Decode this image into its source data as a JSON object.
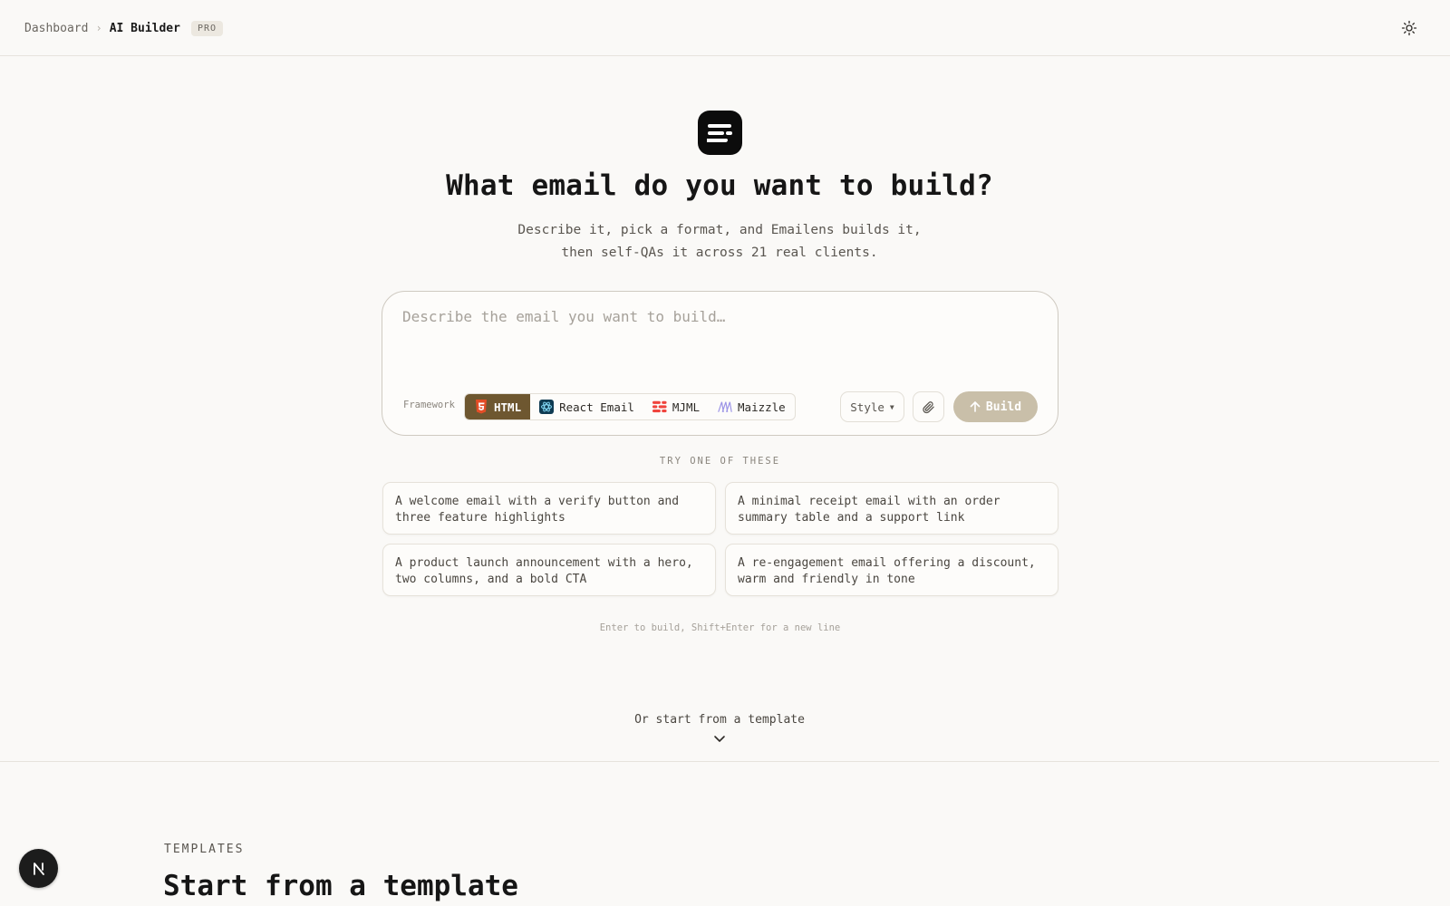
{
  "breadcrumb": {
    "parent": "Dashboard",
    "separator": "›",
    "current": "AI Builder",
    "badge": "PRO"
  },
  "hero": {
    "title": "What email do you want to build?",
    "subtitle_line1": "Describe it, pick a format, and Emailens builds it,",
    "subtitle_line2": "then self-QAs it across 21 real clients."
  },
  "composer": {
    "value": "",
    "placeholder": "Describe the email you want to build…",
    "framework_label": "Framework",
    "frameworks": [
      {
        "label": "HTML",
        "icon": "html5-icon",
        "selected": true
      },
      {
        "label": "React Email",
        "icon": "react-email-icon",
        "selected": false
      },
      {
        "label": "MJML",
        "icon": "mjml-icon",
        "selected": false
      },
      {
        "label": "Maizzle",
        "icon": "maizzle-icon",
        "selected": false
      }
    ],
    "style_label": "Style",
    "attach_icon": "paperclip-icon",
    "build_label": "Build"
  },
  "suggestions": {
    "heading": "TRY ONE OF THESE",
    "items": [
      "A welcome email with a verify button and three feature highlights",
      "A minimal receipt email with an order summary table and a support link",
      "A product launch announcement with a hero, two columns, and a bold CTA",
      "A re-engagement email offering a discount, warm and friendly in tone"
    ],
    "hint": "Enter to build, Shift+Enter for a new line"
  },
  "templates": {
    "link": "Or start from a template",
    "eyebrow": "TEMPLATES",
    "title": "Start from a template"
  },
  "colors": {
    "accent": "#6e5730",
    "build_button": "#c9bfa9",
    "background": "#faf9f7"
  }
}
